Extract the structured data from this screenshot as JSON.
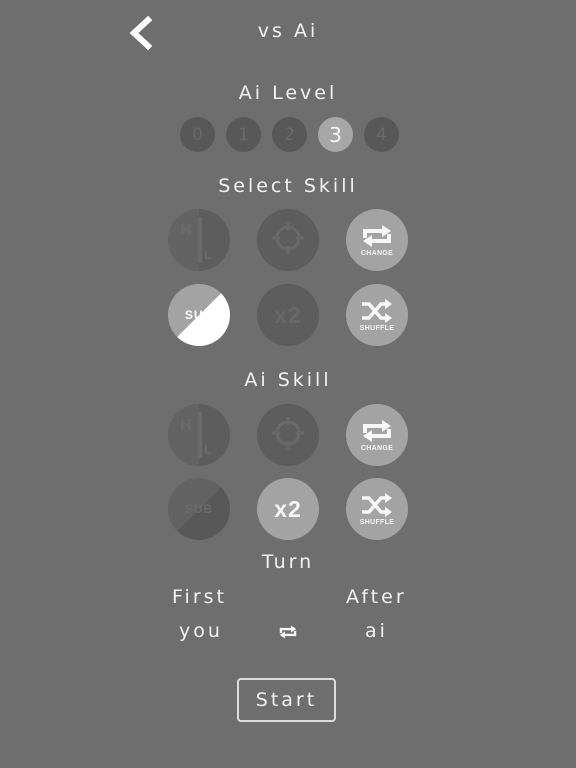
{
  "header": {
    "title": "vs Ai"
  },
  "ai_level": {
    "title": "Ai Level",
    "levels": [
      "0",
      "1",
      "2",
      "3",
      "4"
    ],
    "selected": "3"
  },
  "select_skill": {
    "title": "Select Skill",
    "skills": [
      {
        "id": "hint",
        "icon": "hint-glyph-icon",
        "active": false
      },
      {
        "id": "target",
        "icon": "crosshair-icon",
        "active": false
      },
      {
        "id": "change",
        "icon": "repeat-icon",
        "caption": "CHANGE",
        "active": true
      },
      {
        "id": "sub",
        "label": "SUB",
        "active": true
      },
      {
        "id": "double",
        "label": "x2",
        "active": false
      },
      {
        "id": "shuffle",
        "icon": "shuffle-icon",
        "caption": "SHUFFLE",
        "active": true
      }
    ]
  },
  "ai_skill": {
    "title": "Ai Skill",
    "skills": [
      {
        "id": "hint",
        "icon": "hint-glyph-icon",
        "active": false
      },
      {
        "id": "target",
        "icon": "crosshair-icon",
        "active": false
      },
      {
        "id": "change",
        "icon": "repeat-icon",
        "caption": "CHANGE",
        "active": true
      },
      {
        "id": "sub",
        "label": "SUB",
        "active": false
      },
      {
        "id": "double",
        "label": "x2",
        "active": true
      },
      {
        "id": "shuffle",
        "icon": "shuffle-icon",
        "caption": "SHUFFLE",
        "active": true
      }
    ]
  },
  "turn": {
    "title": "Turn",
    "first_label": "First",
    "first_value": "you",
    "after_label": "After",
    "after_value": "ai",
    "swap_icon": "swap-icon"
  },
  "start": {
    "label": "Start"
  },
  "colors": {
    "background": "#6e6e6e",
    "active_circle": "#a3a3a3",
    "inactive_circle": "#5d5d5d",
    "text": "#f2f2f2"
  }
}
